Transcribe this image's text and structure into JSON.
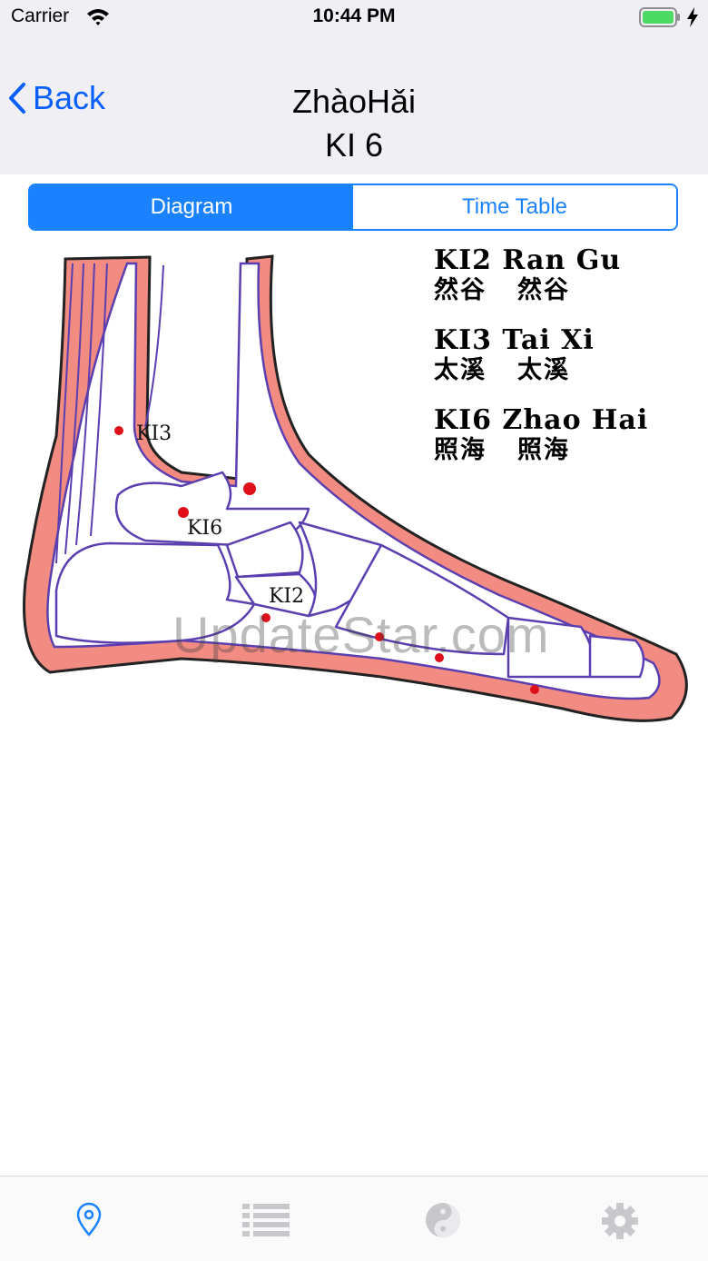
{
  "status_bar": {
    "carrier": "Carrier",
    "time": "10:44 PM"
  },
  "nav": {
    "back_label": "Back",
    "title": "ZhàoHǎi",
    "subtitle": "KI 6"
  },
  "segments": [
    {
      "label": "Diagram",
      "selected": true
    },
    {
      "label": "Time Table",
      "selected": false
    }
  ],
  "diagram": {
    "point_labels": [
      "KI3",
      "KI6",
      "KI2"
    ],
    "legend": [
      {
        "name": "KI2 Ran Gu",
        "chinese_1": "然谷",
        "chinese_2": "然谷"
      },
      {
        "name": "KI3 Tai Xi",
        "chinese_1": "太溪",
        "chinese_2": "太溪"
      },
      {
        "name": "KI6 Zhao Hai",
        "chinese_1": "照海",
        "chinese_2": "照海"
      }
    ],
    "watermark": "UpdateStar.com"
  },
  "tab_bar": {
    "tabs": [
      {
        "icon": "location-pin-icon",
        "active": true
      },
      {
        "icon": "list-icon",
        "active": false
      },
      {
        "icon": "yin-yang-icon",
        "active": false
      },
      {
        "icon": "gear-icon",
        "active": false
      }
    ]
  },
  "colors": {
    "accent": "#1b82ff",
    "back_link": "#0a60ff",
    "skin": "#f28b82",
    "bone_outline": "#5b3fb0",
    "point": "#e0101a"
  }
}
